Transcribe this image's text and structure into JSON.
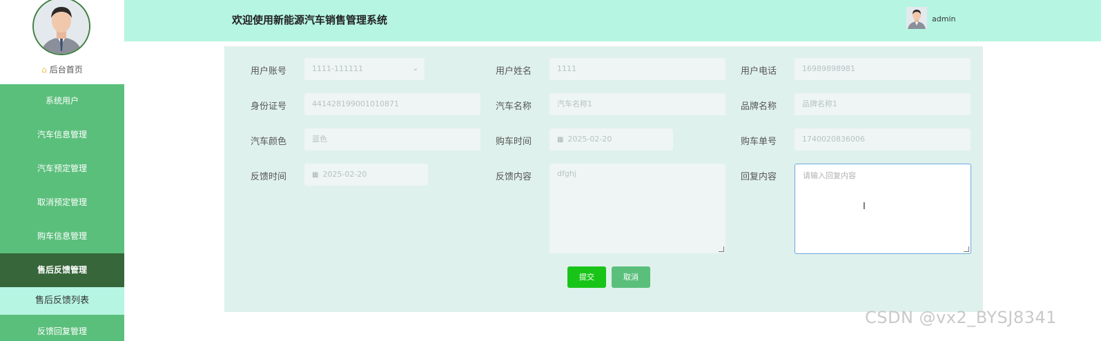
{
  "sidebar": {
    "home_label": "后台首页",
    "items": [
      {
        "label": "系统用户"
      },
      {
        "label": "汽车信息管理"
      },
      {
        "label": "汽车预定管理"
      },
      {
        "label": "取消预定管理"
      },
      {
        "label": "购车信息管理"
      },
      {
        "label": "售后反馈管理"
      }
    ],
    "active_index": 5,
    "sub_item": "售后反馈列表",
    "next_item": "反馈回复管理"
  },
  "header": {
    "title": "欢迎使用新能源汽车销售管理系统",
    "username": "admin"
  },
  "form": {
    "user_account": {
      "label": "用户账号",
      "value": "1111-111111"
    },
    "user_name": {
      "label": "用户姓名",
      "value": "1111"
    },
    "user_phone": {
      "label": "用户电话",
      "value": "16989898981"
    },
    "id_number": {
      "label": "身份证号",
      "value": "441428199001010871"
    },
    "car_name": {
      "label": "汽车名称",
      "value": "汽车名称1"
    },
    "brand_name": {
      "label": "品牌名称",
      "value": "品牌名称1"
    },
    "car_color": {
      "label": "汽车颜色",
      "value": "蓝色"
    },
    "purchase_time": {
      "label": "购车时间",
      "value": "2025-02-20"
    },
    "order_number": {
      "label": "购车单号",
      "value": "1740020836006"
    },
    "feedback_time": {
      "label": "反馈时间",
      "value": "2025-02-20"
    },
    "feedback_content": {
      "label": "反馈内容",
      "value": "dfghj"
    },
    "reply_content": {
      "label": "回复内容",
      "placeholder": "请输入回复内容"
    },
    "submit_label": "提交",
    "cancel_label": "取消"
  },
  "watermark": "CSDN @vx2_BYSJ8341",
  "colors": {
    "sidebar": "#5bbf7c",
    "sidebar_active": "#36663a",
    "header": "#b6f5e2",
    "panel": "#dff1ec",
    "submit": "#19c419"
  }
}
